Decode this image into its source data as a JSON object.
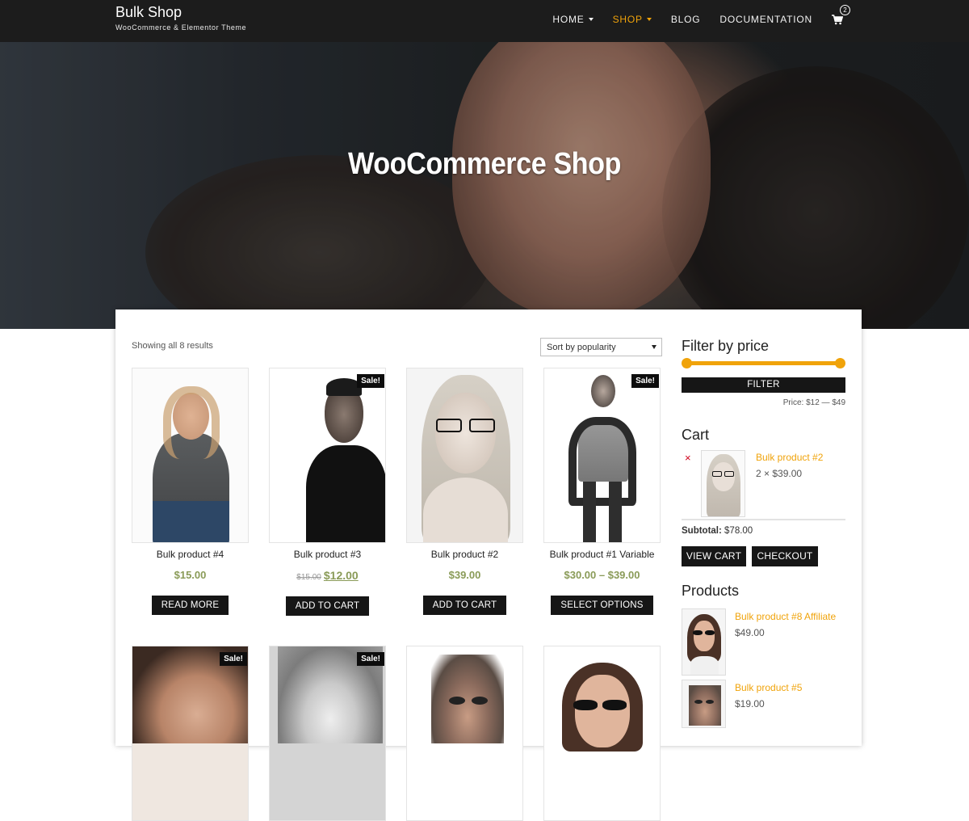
{
  "site": {
    "title": "Bulk Shop",
    "tagline": "WooCommerce & Elementor Theme"
  },
  "nav": {
    "items": [
      {
        "label": "HOME",
        "has_dropdown": true,
        "active": false
      },
      {
        "label": "SHOP",
        "has_dropdown": true,
        "active": true
      },
      {
        "label": "BLOG",
        "has_dropdown": false,
        "active": false
      },
      {
        "label": "DOCUMENTATION",
        "has_dropdown": false,
        "active": false
      }
    ],
    "cart_icon": "shopping-cart-icon",
    "cart_count": "2"
  },
  "hero": {
    "title": "WooCommerce Shop"
  },
  "shop": {
    "result_count": "Showing all 8 results",
    "sort_selected": "Sort by popularity",
    "products": [
      {
        "title": "Bulk product #4",
        "price": "$15.00",
        "old_price": "",
        "sale": false,
        "button": "READ MORE"
      },
      {
        "title": "Bulk product #3",
        "price": "$12.00",
        "old_price": "$15.00",
        "sale": true,
        "button": "ADD TO CART"
      },
      {
        "title": "Bulk product #2",
        "price": "$39.00",
        "old_price": "",
        "sale": false,
        "button": "ADD TO CART"
      },
      {
        "title": "Bulk product #1 Variable",
        "price": "$30.00 – $39.00",
        "old_price": "",
        "sale": true,
        "button": "SELECT OPTIONS"
      }
    ],
    "row2": [
      {
        "sale": true
      },
      {
        "sale": true
      },
      {
        "sale": false
      },
      {
        "sale": false
      }
    ],
    "sale_label": "Sale!"
  },
  "sidebar": {
    "filter": {
      "title": "Filter by price",
      "button": "FILTER",
      "price_label": "Price: $12 — $49",
      "range_min": 12,
      "range_max": 49
    },
    "cart": {
      "title": "Cart",
      "remove_symbol": "×",
      "item_name": "Bulk product #2",
      "item_qty": "2 × $39.00",
      "subtotal_label": "Subtotal:",
      "subtotal_value": "$78.00",
      "view_cart": "VIEW CART",
      "checkout": "CHECKOUT"
    },
    "products": {
      "title": "Products",
      "items": [
        {
          "name": "Bulk product #8 Affiliate",
          "price": "$49.00"
        },
        {
          "name": "Bulk product #5",
          "price": "$19.00"
        }
      ]
    }
  },
  "colors": {
    "accent": "#f0a30a",
    "topbar": "#1c1c1c",
    "price_green": "#8a9b58",
    "remove_red": "#d0021b"
  }
}
